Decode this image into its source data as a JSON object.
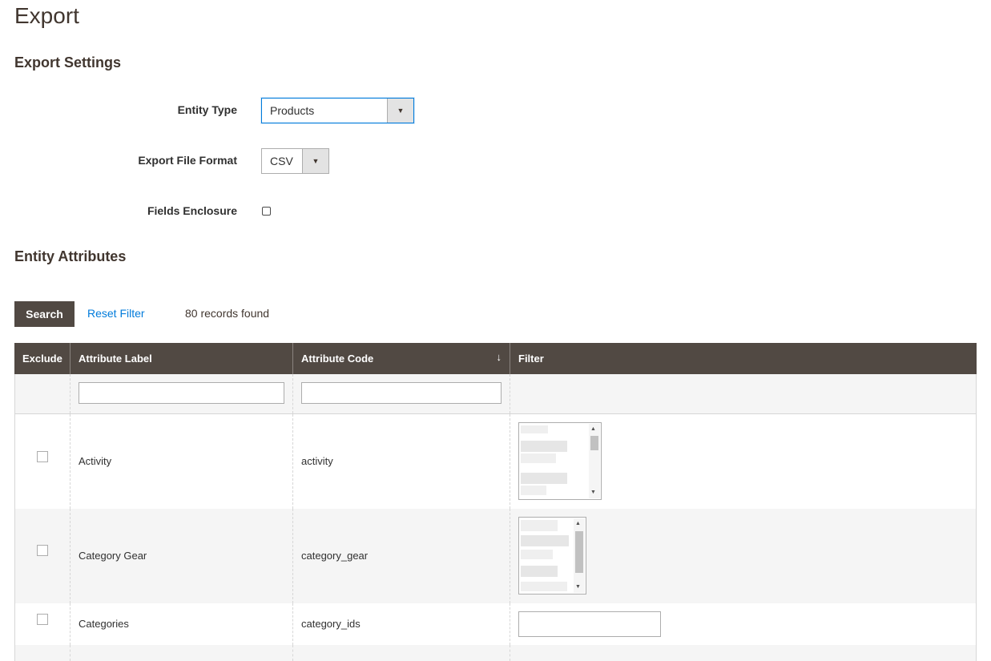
{
  "page": {
    "title": "Export"
  },
  "export_settings": {
    "heading": "Export Settings",
    "entity_type": {
      "label": "Entity Type",
      "value": "Products"
    },
    "file_format": {
      "label": "Export File Format",
      "value": "CSV"
    },
    "fields_enclosure": {
      "label": "Fields Enclosure",
      "checked": false
    }
  },
  "entity_attributes": {
    "heading": "Entity Attributes",
    "search_label": "Search",
    "reset_label": "Reset Filter",
    "records_text": "80 records found"
  },
  "grid": {
    "columns": [
      "Exclude",
      "Attribute Label",
      "Attribute Code",
      "Filter"
    ],
    "sort_arrow": "↓",
    "rows": [
      {
        "label": "Activity",
        "code": "activity",
        "filter_type": "multiselect"
      },
      {
        "label": "Category Gear",
        "code": "category_gear",
        "filter_type": "multiselect"
      },
      {
        "label": "Categories",
        "code": "category_ids",
        "filter_type": "text"
      }
    ]
  },
  "colors": {
    "header_bg": "#514943",
    "link": "#007bdb",
    "focus_border": "#007bdb",
    "row_alt": "#f5f5f5"
  },
  "icons": {
    "select_arrow": "triangle-down-icon",
    "sort": "arrow-down-icon"
  }
}
